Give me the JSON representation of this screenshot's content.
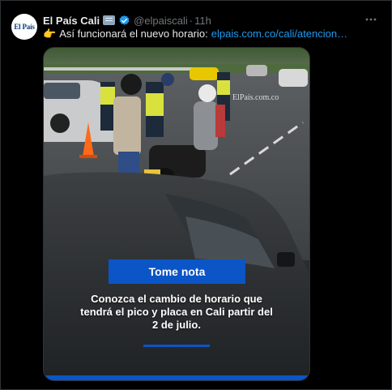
{
  "tweet": {
    "account_name": "El País Cali",
    "handle": "@elpaiscali",
    "separator": "·",
    "time": "11h",
    "avatar_logo_text": "El País",
    "text": "Así funcionará el nuevo horario:",
    "link": "elpais.com.co/cali/atencion…",
    "icons": {
      "flag": "business-flag-icon",
      "verified": "verified-badge-icon",
      "more": "more-icon",
      "pointer": "pointing-hand-icon"
    }
  },
  "media": {
    "watermark": "ElPaís.com.co",
    "card_title": "Tome nota",
    "card_body": "Conozca el cambio de horario que tendrá el pico y placa en Cali partir del 2 de julio.",
    "accent_color": "#0b55c7"
  },
  "colors": {
    "background": "#000000",
    "link": "#1d9bf0",
    "muted": "#71767b",
    "text": "#e7e9ea"
  }
}
